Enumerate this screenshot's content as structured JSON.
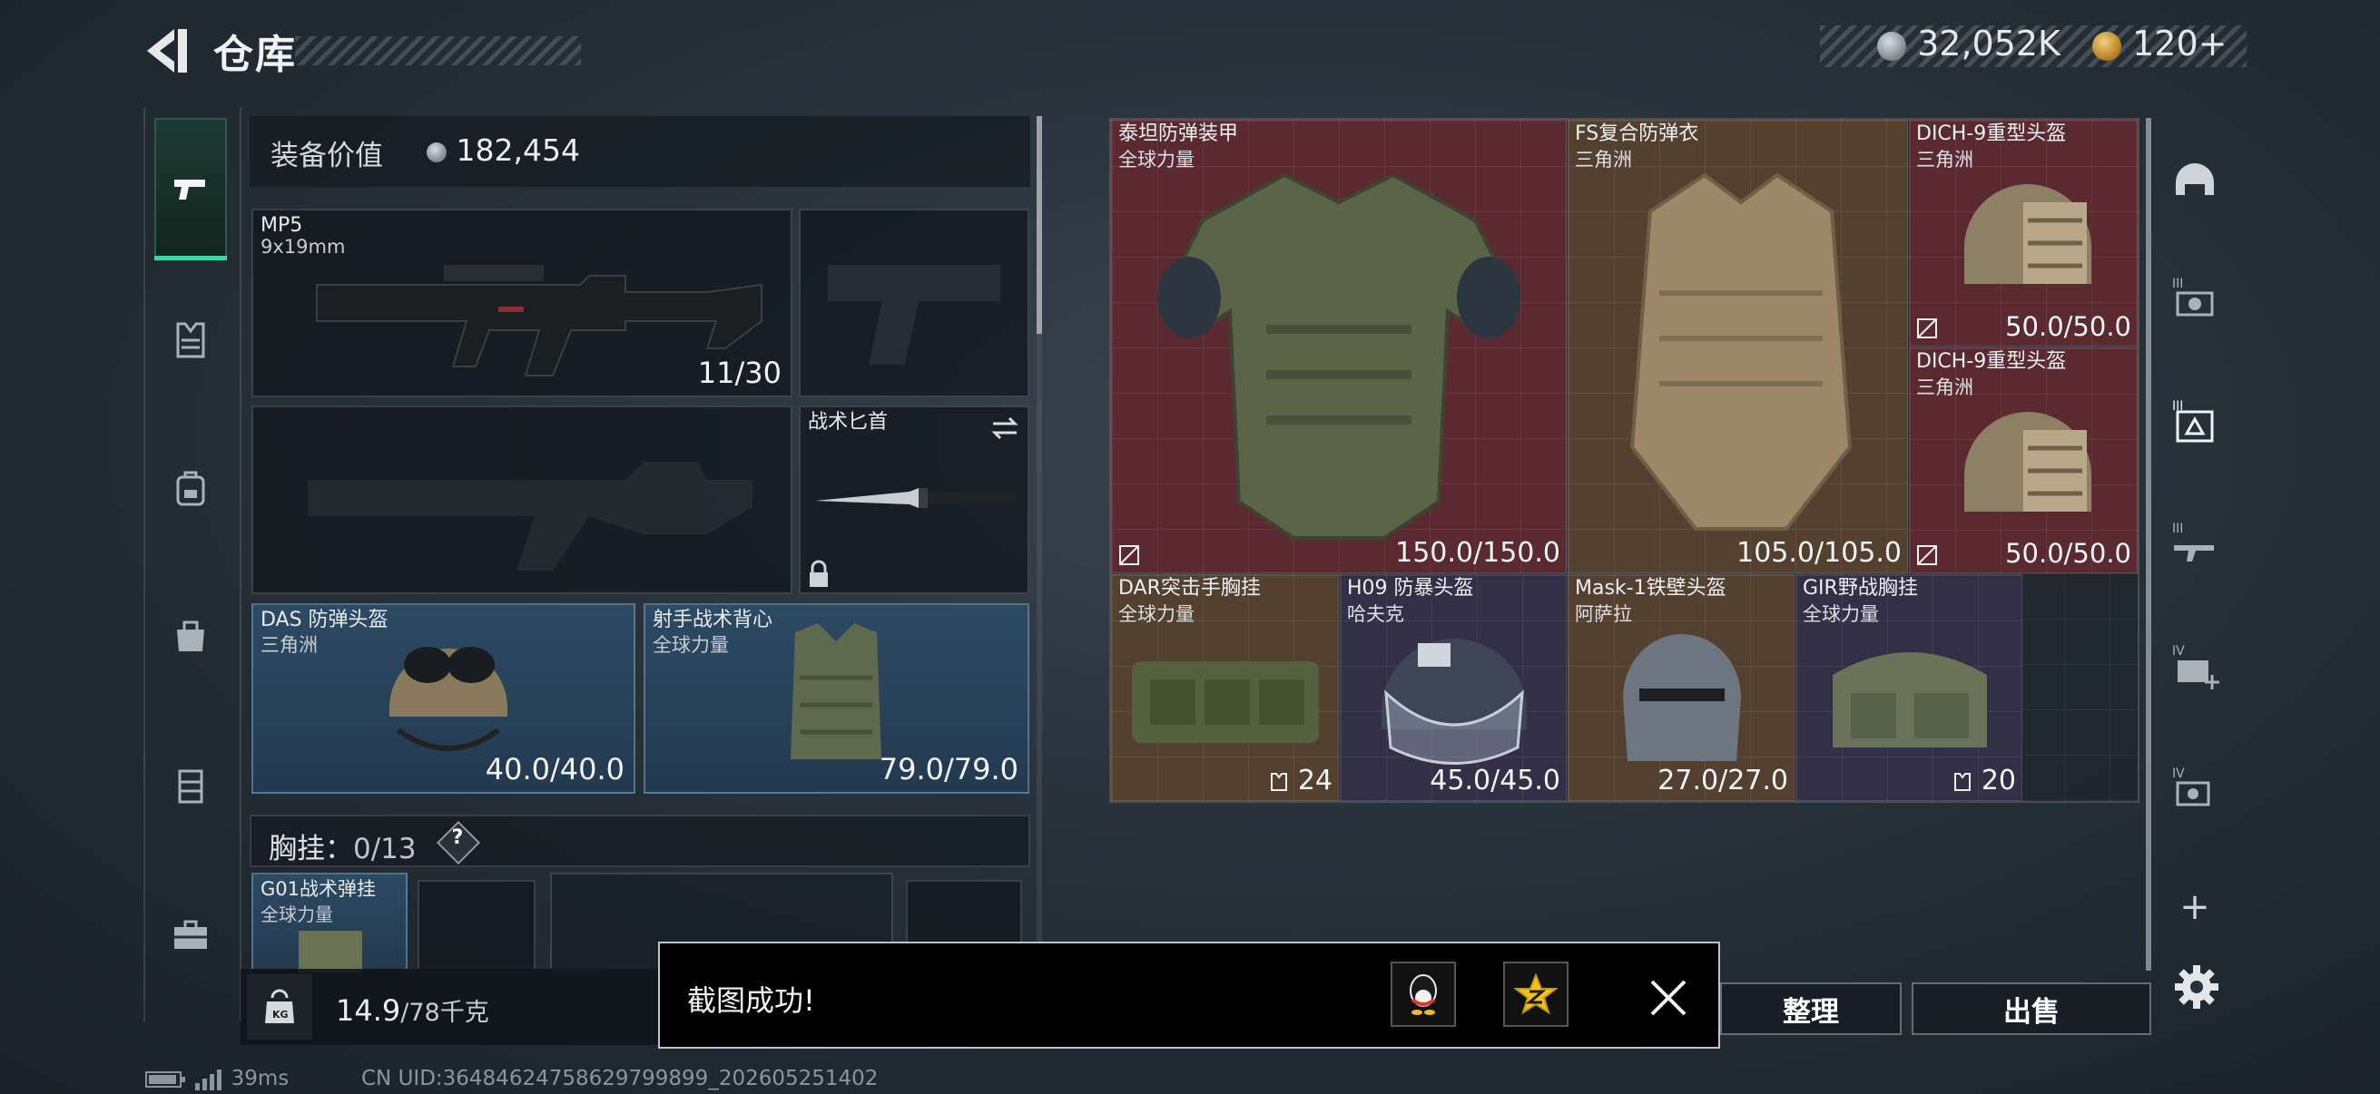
{
  "header": {
    "title": "仓库",
    "currency_primary": "32,052K",
    "currency_secondary": "120+"
  },
  "equipment": {
    "value_label": "装备价值",
    "value": "182,454",
    "slots": {
      "primary_weapon": {
        "name": "MP5",
        "sub": "9x19mm",
        "value": "11/30"
      },
      "melee": {
        "name": "战术匕首"
      },
      "helmet": {
        "name": "DAS 防弹头盔",
        "sub": "三角洲",
        "value": "40.0/40.0"
      },
      "armor": {
        "name": "射手战术背心",
        "sub": "全球力量",
        "value": "79.0/79.0"
      }
    },
    "chest_rig_label": "胸挂：",
    "chest_rig_count": "0/13",
    "chest_rig_help": "?",
    "chest_rig_item": {
      "name": "G01战术弹挂",
      "sub": "全球力量"
    }
  },
  "weight": {
    "current": "14.9",
    "max": "/78千克"
  },
  "storage": {
    "items": [
      {
        "name": "泰坦防弹装甲",
        "sub": "全球力量",
        "value": "150.0/150.0"
      },
      {
        "name": "FS复合防弹衣",
        "sub": "三角洲",
        "value": "105.0/105.0"
      },
      {
        "name": "DICH-9重型头盔",
        "sub": "三角洲",
        "value": "50.0/50.0"
      },
      {
        "name": "DICH-9重型头盔",
        "sub": "三角洲",
        "value": "50.0/50.0"
      },
      {
        "name": "DAR突击手胸挂",
        "sub": "全球力量",
        "value": "24"
      },
      {
        "name": "H09 防暴头盔",
        "sub": "哈夫克",
        "value": "45.0/45.0"
      },
      {
        "name": "Mask-1铁壁头盔",
        "sub": "阿萨拉",
        "value": "27.0/27.0"
      },
      {
        "name": "GIR野战胸挂",
        "sub": "全球力量",
        "value": "20"
      }
    ]
  },
  "actions": {
    "sort": "整理",
    "sell": "出售",
    "add": "+"
  },
  "toast": {
    "message": "截图成功!"
  },
  "status": {
    "ping": "39ms",
    "uid": "CN UID:36484624758629799899_202605251402"
  },
  "colors": {
    "accent": "#3fd69f",
    "rarity_red": "#5a2a30",
    "rarity_gold": "#54402f",
    "rarity_purple": "#322f47",
    "slot_blue": "#2d4a63"
  },
  "icons": {
    "left_nav": [
      "pistol-icon",
      "armor-vest-icon",
      "backpack-icon",
      "bag-icon",
      "locker-icon",
      "briefcase-icon"
    ],
    "right_nav": [
      "helmet-icon",
      "tier3-camera-icon",
      "tier3-crate-icon",
      "tier3-rifle-icon",
      "tier4-medkit-icon",
      "tier4-gear-icon",
      "plus-icon",
      "settings-icon"
    ]
  }
}
